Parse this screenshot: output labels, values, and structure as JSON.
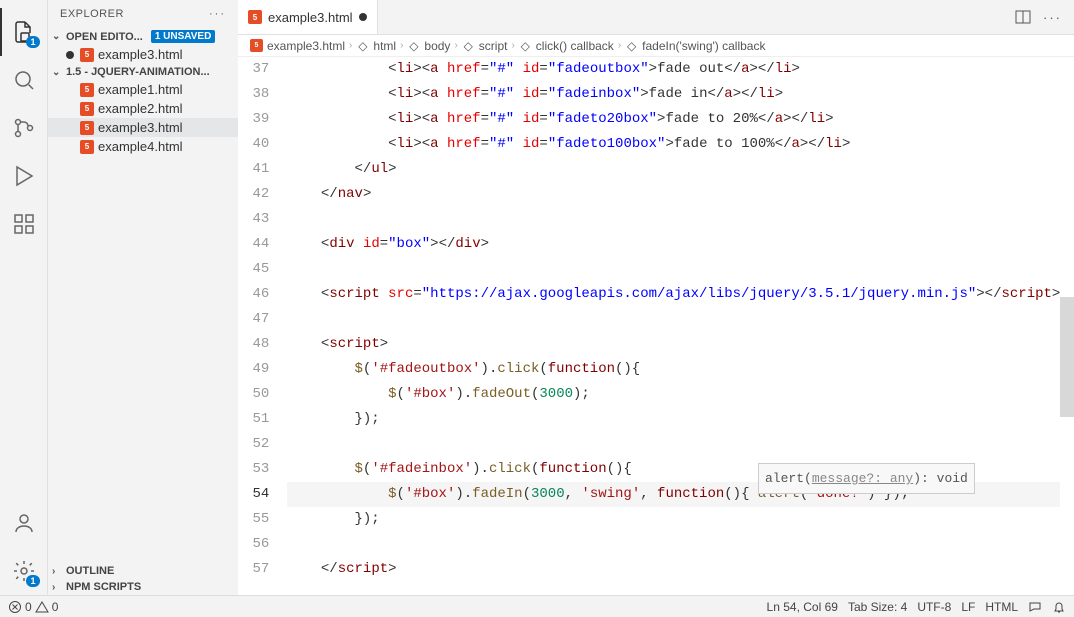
{
  "sidebar": {
    "title": "EXPLORER",
    "open_editors_label": "OPEN EDITO...",
    "unsaved_badge": "1 UNSAVED",
    "folder_label": "1.5 - JQUERY-ANIMATION...",
    "open_editor_file": "example3.html",
    "files": [
      "example1.html",
      "example2.html",
      "example3.html",
      "example4.html"
    ],
    "outline_label": "OUTLINE",
    "npm_label": "NPM SCRIPTS"
  },
  "tab": {
    "label": "example3.html"
  },
  "breadcrumbs": [
    "example3.html",
    "html",
    "body",
    "script",
    "click() callback",
    "fadeIn('swing') callback"
  ],
  "activity_badge": "1",
  "settings_badge": "1",
  "line_numbers": [
    "37",
    "38",
    "39",
    "40",
    "41",
    "42",
    "43",
    "44",
    "45",
    "46",
    "47",
    "48",
    "49",
    "50",
    "51",
    "52",
    "53",
    "54",
    "55",
    "56",
    "57"
  ],
  "code": {
    "l37": {
      "pre": "            ",
      "id": "fadeoutbox",
      "txt": "fade out"
    },
    "l38": {
      "pre": "            ",
      "id": "fadeinbox",
      "txt": "fade in"
    },
    "l39": {
      "pre": "            ",
      "id": "fadeto20box",
      "txt": "fade to 20%"
    },
    "l40": {
      "pre": "            ",
      "id": "fadeto100box",
      "txt": "fade to 100%"
    },
    "l41": "        </ul>",
    "l42": "    </nav>",
    "l44_id": "box",
    "l46_src": "https://ajax.googleapis.com/ajax/libs/jquery/3.5.1/jquery.min.js",
    "l49_sel": "'#fadeoutbox'",
    "l50_sel": "'#box'",
    "l50_num": "3000",
    "l53_sel": "'#fadeinbox'",
    "l54_sel": "'#box'",
    "l54_num": "3000",
    "l54_swing": "'swing'",
    "l54_done": "'done!'"
  },
  "hint": {
    "prefix": "alert(",
    "param": "message?: any",
    "suffix": "): void"
  },
  "status": {
    "errors": "0",
    "warnings": "0",
    "position": "Ln 54, Col 69",
    "spaces": "Tab Size: 4",
    "encoding": "UTF-8",
    "eol": "LF",
    "lang": "HTML"
  }
}
